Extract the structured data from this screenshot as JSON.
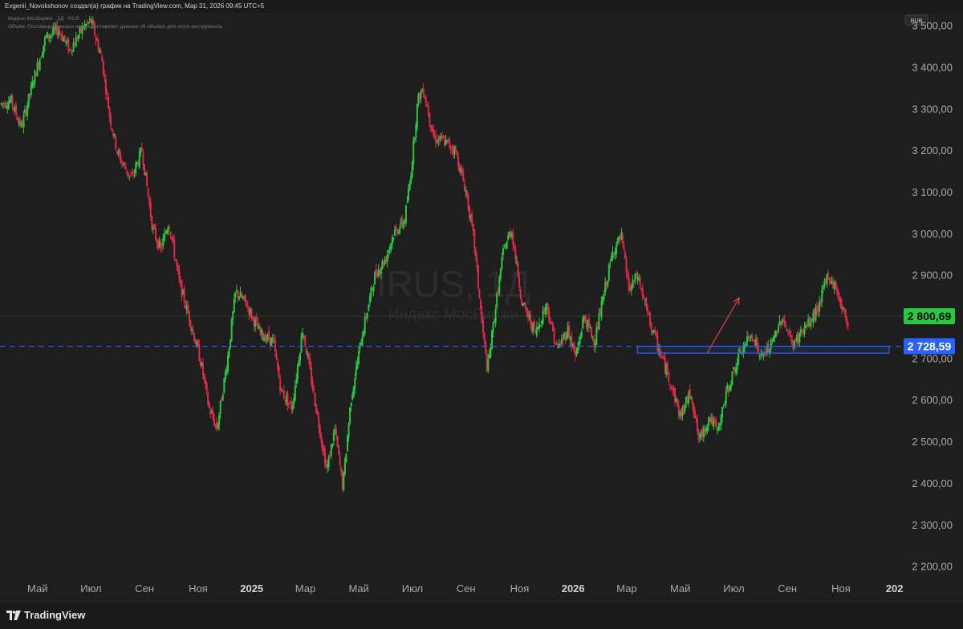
{
  "header": {
    "publisher": "Evgenii_Novokshonov создал(а) график на TradingView.com, Мар 31, 2026 09:45 UTC+5",
    "instrument": "Индекс МосБиржи · 1Д · RUS",
    "volume_note": "Объём: Поставщик данных не предоставляет данные об объёме для этого инструмента.",
    "currency": "RUB"
  },
  "watermark": {
    "symbol": "IRUS, 1Д",
    "name": "Индекс МосБиржи"
  },
  "footer": {
    "brand": "TradingView"
  },
  "colors": {
    "background": "#1e1e1e",
    "up": "#26c940",
    "down": "#e0294a",
    "current_price_badge": "#26c940",
    "level_badge": "#2962ff",
    "level_line": "#2962ff",
    "arrow": "#e04050",
    "zone": "#2962ff"
  },
  "chart_data": {
    "type": "candlestick",
    "title": "",
    "y_axis": {
      "ticks": [
        "3 500,00",
        "3 400,00",
        "3 300,00",
        "3 200,00",
        "3 100,00",
        "3 000,00",
        "2 900,00",
        "2 800,00",
        "2 700,00",
        "2 600,00",
        "2 500,00",
        "2 400,00",
        "2 300,00",
        "2 200,00"
      ],
      "tick_values": [
        3500,
        3400,
        3300,
        3200,
        3100,
        3000,
        2900,
        2800,
        2700,
        2600,
        2500,
        2400,
        2300,
        2200
      ],
      "range": [
        2180,
        3530
      ]
    },
    "x_axis": {
      "labels": [
        "Май",
        "Июл",
        "Сен",
        "Ноя",
        "2025",
        "Мар",
        "Май",
        "Июл",
        "Сен",
        "Ноя",
        "2026",
        "Мар",
        "Май",
        "Июл",
        "Сен",
        "Ноя",
        "202"
      ],
      "bold": [
        false,
        false,
        false,
        false,
        true,
        false,
        false,
        false,
        false,
        false,
        true,
        false,
        false,
        false,
        false,
        false,
        true
      ],
      "label_months": [
        4,
        6,
        8,
        10,
        12,
        14,
        16,
        18,
        20,
        22,
        24,
        26,
        28,
        30,
        32,
        34,
        36
      ],
      "start_month": 2.6,
      "end_month": 36.1,
      "data_end_month": 26.55
    },
    "price_path": [
      [
        2.6,
        3310
      ],
      [
        3.0,
        3320
      ],
      [
        3.4,
        3255
      ],
      [
        3.9,
        3380
      ],
      [
        4.3,
        3470
      ],
      [
        4.8,
        3490
      ],
      [
        5.2,
        3440
      ],
      [
        5.7,
        3495
      ],
      [
        6.0,
        3510
      ],
      [
        6.4,
        3420
      ],
      [
        6.7,
        3280
      ],
      [
        7.0,
        3190
      ],
      [
        7.5,
        3130
      ],
      [
        7.9,
        3200
      ],
      [
        8.3,
        3010
      ],
      [
        8.6,
        2960
      ],
      [
        8.9,
        3030
      ],
      [
        9.3,
        2880
      ],
      [
        9.7,
        2790
      ],
      [
        10.1,
        2690
      ],
      [
        10.4,
        2580
      ],
      [
        10.7,
        2530
      ],
      [
        11.1,
        2700
      ],
      [
        11.4,
        2860
      ],
      [
        11.8,
        2830
      ],
      [
        12.3,
        2760
      ],
      [
        12.8,
        2740
      ],
      [
        13.1,
        2620
      ],
      [
        13.5,
        2580
      ],
      [
        13.9,
        2770
      ],
      [
        14.3,
        2620
      ],
      [
        14.8,
        2430
      ],
      [
        15.1,
        2530
      ],
      [
        15.4,
        2390
      ],
      [
        15.7,
        2600
      ],
      [
        16.1,
        2750
      ],
      [
        16.6,
        2900
      ],
      [
        17.0,
        2940
      ],
      [
        17.3,
        3000
      ],
      [
        17.7,
        3030
      ],
      [
        17.9,
        3120
      ],
      [
        18.2,
        3320
      ],
      [
        18.4,
        3350
      ],
      [
        18.8,
        3230
      ],
      [
        19.2,
        3220
      ],
      [
        19.6,
        3200
      ],
      [
        20.0,
        3100
      ],
      [
        20.3,
        2980
      ],
      [
        20.6,
        2780
      ],
      [
        20.8,
        2670
      ],
      [
        21.1,
        2820
      ],
      [
        21.4,
        2960
      ],
      [
        21.7,
        3010
      ],
      [
        22.1,
        2830
      ],
      [
        22.6,
        2760
      ],
      [
        23.0,
        2830
      ],
      [
        23.4,
        2720
      ],
      [
        23.8,
        2770
      ],
      [
        24.1,
        2700
      ],
      [
        24.4,
        2800
      ],
      [
        24.8,
        2740
      ],
      [
        25.2,
        2870
      ],
      [
        25.5,
        2960
      ],
      [
        25.8,
        2990
      ],
      [
        26.1,
        2860
      ],
      [
        26.4,
        2900
      ],
      [
        26.8,
        2800
      ],
      [
        27.2,
        2720
      ],
      [
        27.6,
        2650
      ],
      [
        28.0,
        2560
      ],
      [
        28.4,
        2620
      ],
      [
        28.7,
        2500
      ],
      [
        29.1,
        2560
      ],
      [
        29.4,
        2520
      ],
      [
        29.7,
        2610
      ],
      [
        30.0,
        2670
      ],
      [
        30.3,
        2720
      ],
      [
        30.7,
        2760
      ],
      [
        31.0,
        2700
      ],
      [
        31.4,
        2730
      ],
      [
        31.8,
        2800
      ],
      [
        32.2,
        2730
      ],
      [
        32.5,
        2760
      ],
      [
        32.9,
        2790
      ],
      [
        33.2,
        2830
      ],
      [
        33.5,
        2900
      ],
      [
        33.8,
        2870
      ],
      [
        34.1,
        2810
      ],
      [
        34.3,
        2780
      ]
    ],
    "current_price": {
      "label": "2 800,69",
      "value": 2800.69
    },
    "level": {
      "label": "2 728,59",
      "value": 2728.59
    },
    "zone": {
      "from_month": 26.4,
      "to_month": 35.8,
      "low": 2712,
      "high": 2728.59
    },
    "arrow": {
      "from_month": 29.0,
      "from_value": 2712,
      "to_month": 30.2,
      "to_value": 2845
    }
  }
}
